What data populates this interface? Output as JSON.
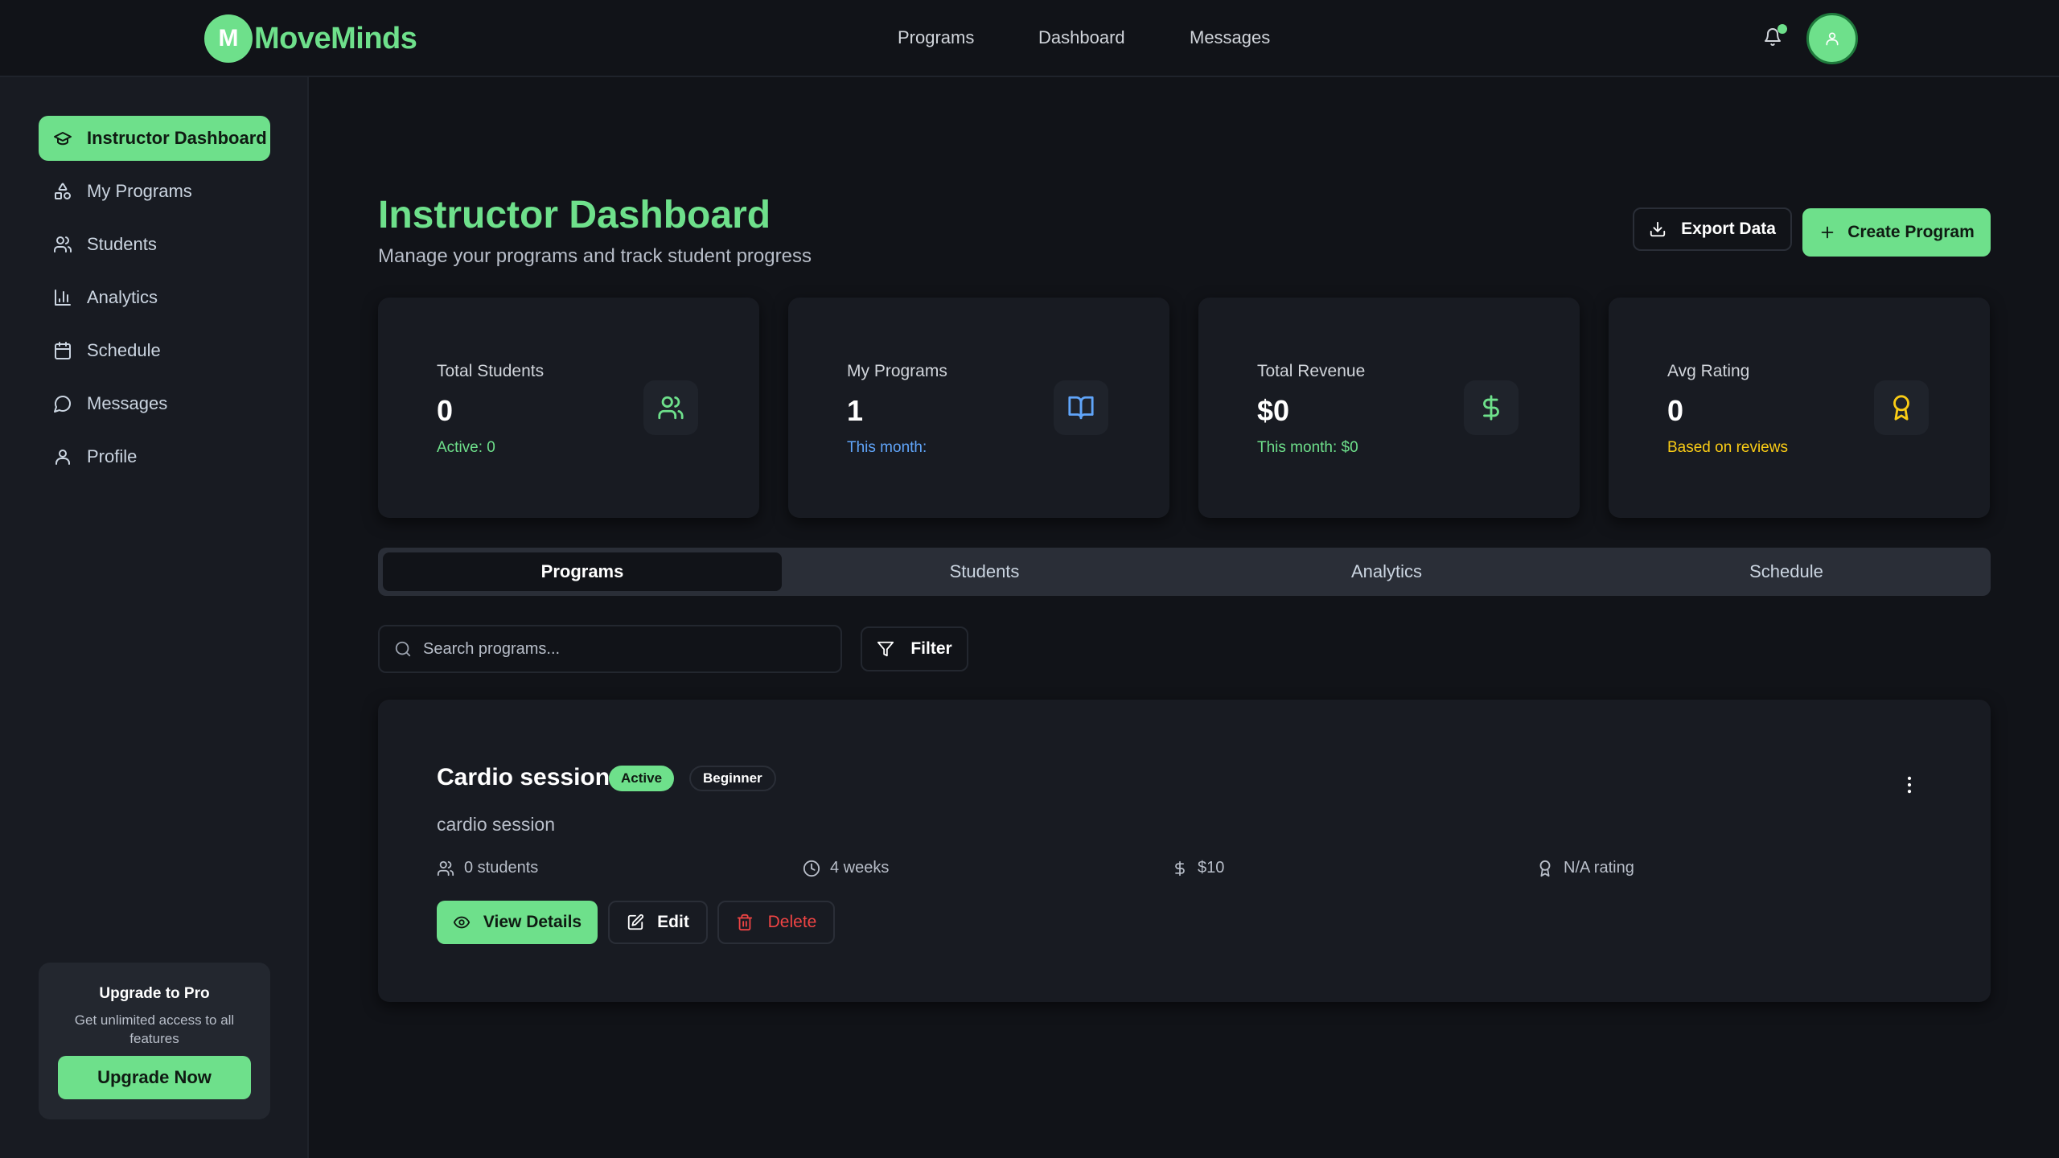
{
  "brand": {
    "badge": "M",
    "name": "MoveMinds",
    "accent": "#6ee08b"
  },
  "topnav": {
    "items": [
      {
        "label": "Programs"
      },
      {
        "label": "Dashboard"
      },
      {
        "label": "Messages"
      }
    ]
  },
  "header": {
    "bell_icon": "bell-icon",
    "avatar_icon": "user-icon"
  },
  "sidebar": {
    "items": [
      {
        "label": "Instructor Dashboard",
        "icon": "graduation-cap-icon",
        "active": true
      },
      {
        "label": "My Programs",
        "icon": "shapes-icon"
      },
      {
        "label": "Students",
        "icon": "users-icon"
      },
      {
        "label": "Analytics",
        "icon": "bar-chart-icon"
      },
      {
        "label": "Schedule",
        "icon": "calendar-icon"
      },
      {
        "label": "Messages",
        "icon": "message-icon"
      },
      {
        "label": "Profile",
        "icon": "user-icon"
      }
    ],
    "upgrade": {
      "title": "Upgrade to Pro",
      "subtitle": "Get unlimited access to all features",
      "button": "Upgrade Now"
    }
  },
  "main": {
    "title": "Instructor Dashboard",
    "subtitle": "Manage your programs and track student progress",
    "export_label": "Export Data",
    "create_label": "Create Program",
    "stats": [
      {
        "label": "Total Students",
        "value": "0",
        "note": "Active: 0",
        "note_color": "#6ee08b",
        "icon": "users-icon"
      },
      {
        "label": "My Programs",
        "value": "1",
        "note": "This month:",
        "note_color": "#60a5fa",
        "icon": "book-open-icon"
      },
      {
        "label": "Total Revenue",
        "value": "$0",
        "note": "This month: $0",
        "note_color": "#6ee08b",
        "icon": "dollar-icon"
      },
      {
        "label": "Avg Rating",
        "value": "0",
        "note": "Based on reviews",
        "note_color": "#facc15",
        "icon": "award-icon"
      }
    ],
    "tabs": [
      {
        "label": "Programs",
        "active": true
      },
      {
        "label": "Students"
      },
      {
        "label": "Analytics"
      },
      {
        "label": "Schedule"
      }
    ],
    "search": {
      "placeholder": "Search programs...",
      "value": ""
    },
    "filter_label": "Filter",
    "program": {
      "title": "Cardio session",
      "status": "Active",
      "level": "Beginner",
      "description": "cardio session",
      "students": "0 students",
      "duration": "4 weeks",
      "price": "$10",
      "rating": "N/A rating",
      "view_label": "View Details",
      "edit_label": "Edit",
      "delete_label": "Delete"
    }
  }
}
